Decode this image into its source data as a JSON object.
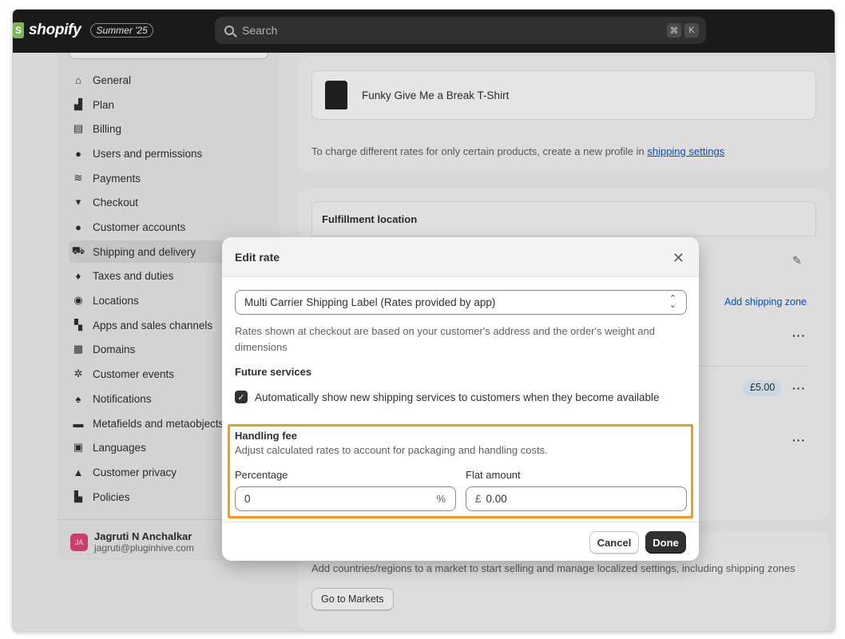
{
  "topbar": {
    "brand": "shopify",
    "edition": "Summer '25",
    "search_placeholder": "Search",
    "shortcut_keys": [
      "⌘",
      "K"
    ]
  },
  "sidebar": {
    "items": [
      {
        "label": "General",
        "icon": "store-icon"
      },
      {
        "label": "Plan",
        "icon": "plan-icon"
      },
      {
        "label": "Billing",
        "icon": "billing-icon"
      },
      {
        "label": "Users and permissions",
        "icon": "users-icon"
      },
      {
        "label": "Payments",
        "icon": "payments-icon"
      },
      {
        "label": "Checkout",
        "icon": "cart-icon"
      },
      {
        "label": "Customer accounts",
        "icon": "person-icon"
      },
      {
        "label": "Shipping and delivery",
        "icon": "truck-icon",
        "active": true
      },
      {
        "label": "Taxes and duties",
        "icon": "tax-icon"
      },
      {
        "label": "Locations",
        "icon": "location-icon"
      },
      {
        "label": "Apps and sales channels",
        "icon": "apps-icon"
      },
      {
        "label": "Domains",
        "icon": "domains-icon"
      },
      {
        "label": "Customer events",
        "icon": "events-icon"
      },
      {
        "label": "Notifications",
        "icon": "bell-icon"
      },
      {
        "label": "Metafields and metaobjects",
        "icon": "metafields-icon"
      },
      {
        "label": "Languages",
        "icon": "language-icon"
      },
      {
        "label": "Customer privacy",
        "icon": "lock-icon"
      },
      {
        "label": "Policies",
        "icon": "policies-icon"
      }
    ],
    "user": {
      "initials": "JA",
      "name": "Jagruti N Anchalkar",
      "email": "jagruti@pluginhive.com"
    }
  },
  "main": {
    "product_name": "Funky Give Me a Break T-Shirt",
    "profile_note": "To charge different rates for only certain products, create a new profile in",
    "profile_link": "shipping settings",
    "fulfillment_heading": "Fulfillment location",
    "add_zone_link": "Add shipping zone",
    "rate_price": "£5.00",
    "markets_text": "Add countries/regions to a market to start selling and manage localized settings, including shipping zones",
    "markets_button": "Go to Markets"
  },
  "modal": {
    "title": "Edit rate",
    "select_value": "Multi Carrier Shipping Label (Rates provided by app)",
    "help_text": "Rates shown at checkout are based on your customer's address and the order's weight and dimensions",
    "future_heading": "Future services",
    "future_checkbox_label": "Automatically show new shipping services to customers when they become available",
    "future_checked": true,
    "handling_heading": "Handling fee",
    "handling_desc": "Adjust calculated rates to account for packaging and handling costs.",
    "percentage_label": "Percentage",
    "percentage_value": "0",
    "percentage_suffix": "%",
    "flat_label": "Flat amount",
    "flat_prefix": "£",
    "flat_value": "0.00",
    "cancel_label": "Cancel",
    "done_label": "Done",
    "highlight_color": "#f39a1f"
  }
}
